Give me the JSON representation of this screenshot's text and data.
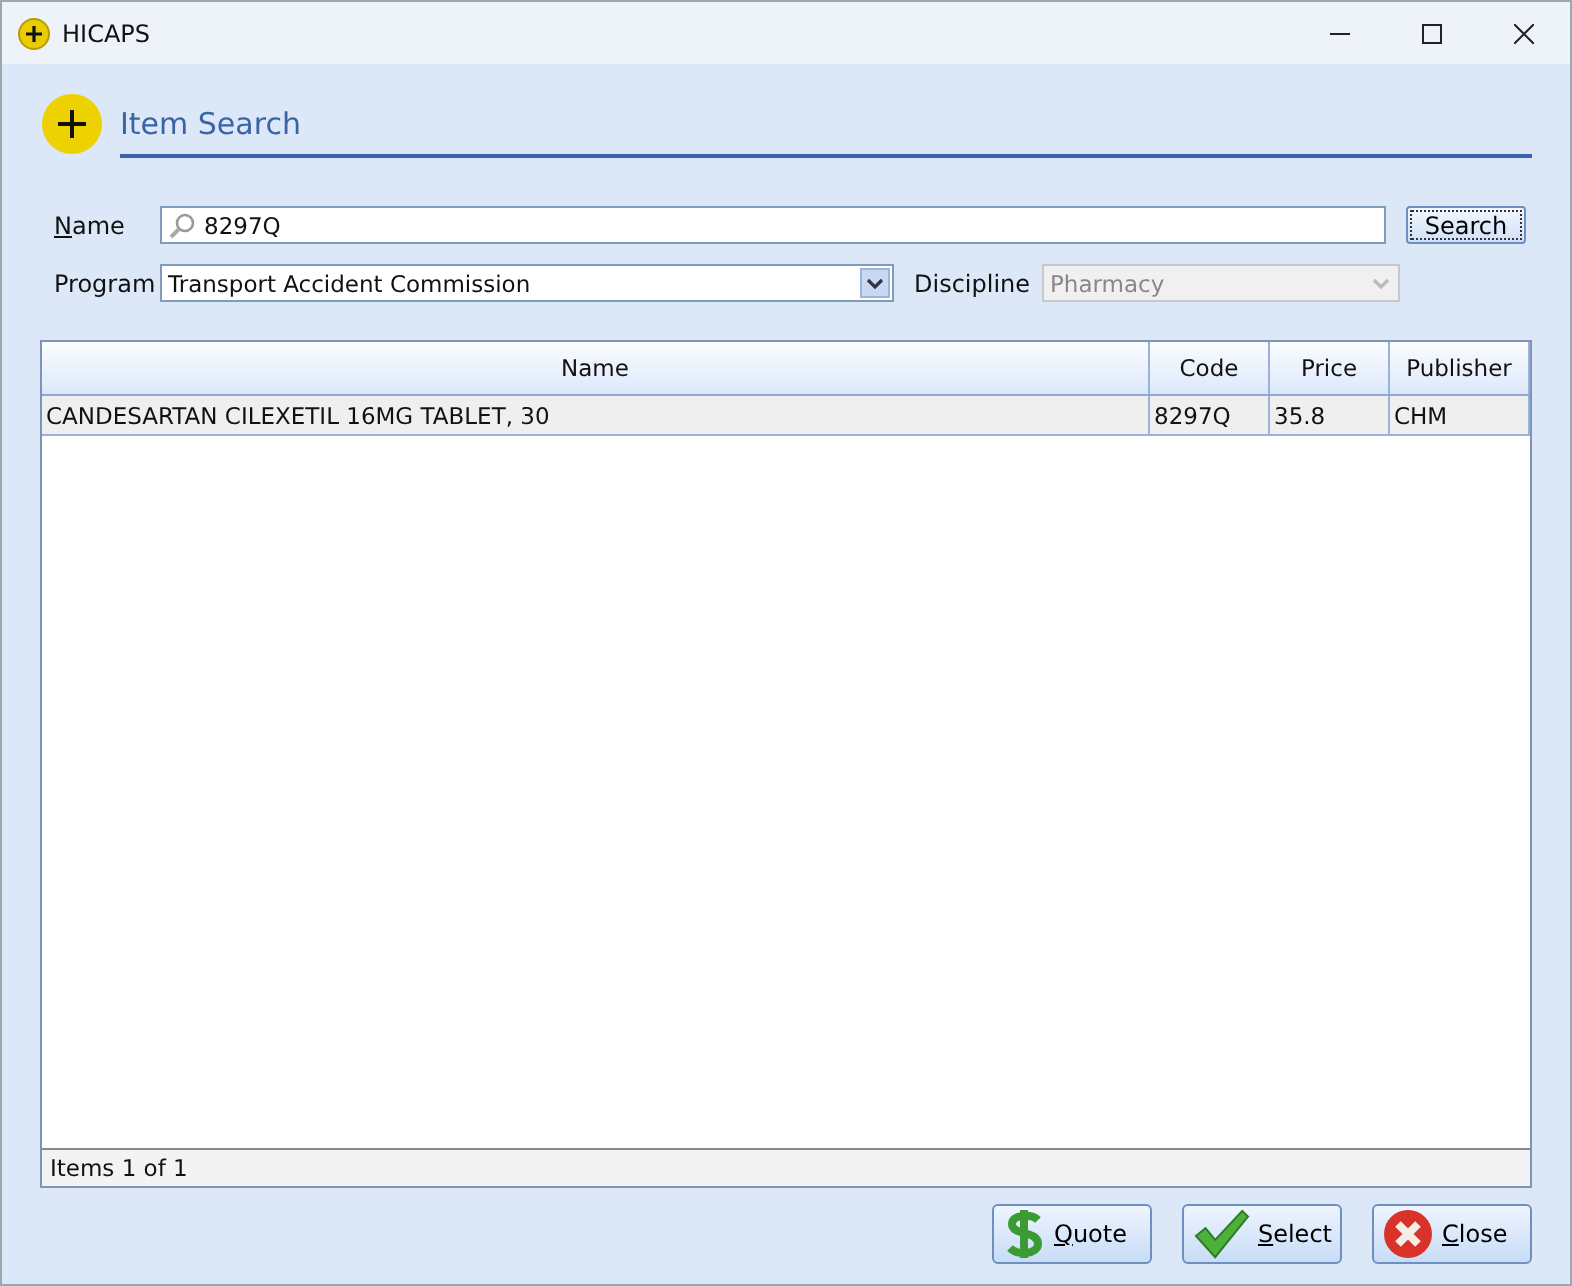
{
  "window": {
    "title": "HICAPS"
  },
  "header": {
    "title": "Item Search"
  },
  "form": {
    "name": {
      "label": [
        {
          "text": "N",
          "underlined": true
        },
        {
          "text": "ame",
          "underlined": false
        }
      ],
      "value": "8297Q"
    },
    "search_button": {
      "label": "Search",
      "focused": true
    },
    "program": {
      "label": "Program",
      "value": "Transport Accident Commission",
      "disabled": false
    },
    "discipline": {
      "label": "Discipline",
      "value": "Pharmacy",
      "disabled": true
    }
  },
  "table": {
    "columns": [
      "Name",
      "Code",
      "Price",
      "Publisher"
    ],
    "rows": [
      {
        "cells": [
          "CANDESARTAN CILEXETIL 16MG TABLET, 30",
          "8297Q",
          "35.8",
          "CHM"
        ],
        "selected": true
      }
    ],
    "status": "Items 1 of 1"
  },
  "buttons": [
    {
      "kind": "quote",
      "label": [
        {
          "text": "Q",
          "underlined": true
        },
        {
          "text": "uote",
          "underlined": false
        }
      ]
    },
    {
      "kind": "select",
      "label": [
        {
          "text": "S",
          "underlined": true
        },
        {
          "text": "elect",
          "underlined": false
        }
      ]
    },
    {
      "kind": "close",
      "label": [
        {
          "text": "C",
          "underlined": true
        },
        {
          "text": "lose",
          "underlined": false
        }
      ]
    }
  ]
}
